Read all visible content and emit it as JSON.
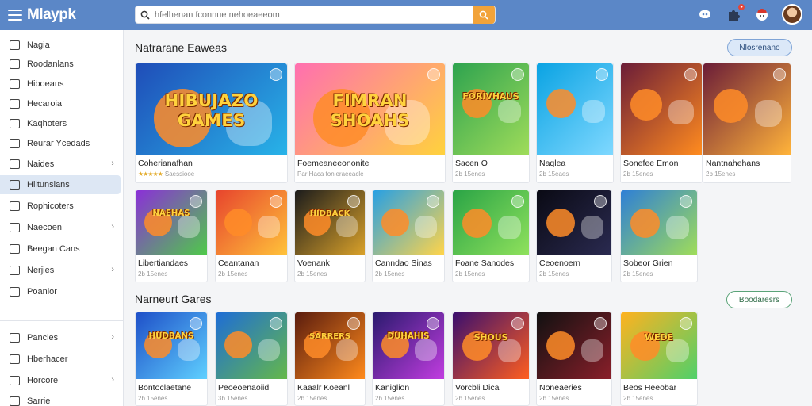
{
  "header": {
    "logo": "Mlaypk",
    "search_placeholder": "hfelhenan fconnue nehoeaeeom"
  },
  "sidebar": {
    "items": [
      {
        "label": "Nagia",
        "chevron": false
      },
      {
        "label": "Roodanlans",
        "chevron": false
      },
      {
        "label": "Hiboeans",
        "chevron": false
      },
      {
        "label": "Hecaroia",
        "chevron": false
      },
      {
        "label": "Kaqhoters",
        "chevron": false
      },
      {
        "label": "Reurar Ycedads",
        "chevron": false
      },
      {
        "label": "Naides",
        "chevron": true
      },
      {
        "label": "Hiltunsians",
        "chevron": false,
        "active": true
      },
      {
        "label": "Rophicoters",
        "chevron": false
      },
      {
        "label": "Naecoen",
        "chevron": true
      },
      {
        "label": "Beegan Cans",
        "chevron": false
      },
      {
        "label": "Nerjies",
        "chevron": true
      },
      {
        "label": "Poanlor",
        "chevron": false
      }
    ],
    "bottom_items": [
      {
        "label": "Pancies",
        "chevron": true
      },
      {
        "label": "Hberhacer",
        "chevron": false
      },
      {
        "label": "Horcore",
        "chevron": true
      },
      {
        "label": "Sarrie",
        "chevron": false
      }
    ]
  },
  "sections": [
    {
      "title": "Natrarane Eaweas",
      "button": "Nlosrenano"
    },
    {
      "title": "Narneurt Gares",
      "button": "Boodaresrs"
    }
  ],
  "featured": [
    {
      "title": "Coherianafhan",
      "meta": "Saessiooe",
      "rating": "★★★★★",
      "thumb_text": "HIBUJAZO GAMES",
      "bg": [
        "#1f4db8",
        "#28b3e8"
      ]
    },
    {
      "title": "Foemeaneeononite",
      "meta": "Par Haca fonieraeeacle",
      "thumb_text": "FIMRAN SHOAHS",
      "bg": [
        "#ff6fb0",
        "#ffd23d"
      ]
    },
    {
      "title": "Sacen O",
      "meta": "2b 15enes",
      "thumb_text": "FORIVHAUS",
      "bg": [
        "#2ea34f",
        "#9fdc5a"
      ]
    },
    {
      "title": "Naqlea",
      "meta": "2b 15eaes",
      "thumb_text": "",
      "bg": [
        "#0aa3e3",
        "#7fd8ff"
      ]
    },
    {
      "title": "Sonefee Emon",
      "meta": "2b 15enes",
      "thumb_text": "",
      "bg": [
        "#6b1d38",
        "#ff8b1f"
      ]
    },
    {
      "title": "Nantnahehans",
      "meta": "2b 15enes",
      "thumb_text": "",
      "bg": [
        "#6b1d38",
        "#ffb33a"
      ]
    }
  ],
  "row2": [
    {
      "title": "Libertiandaes",
      "meta": "2b 15enes",
      "thumb_text": "NAEHAS",
      "bg": [
        "#8b2fd8",
        "#4fc94a"
      ]
    },
    {
      "title": "Ceantanan",
      "meta": "2b 15enes",
      "thumb_text": "",
      "bg": [
        "#e7442d",
        "#ffc23a"
      ]
    },
    {
      "title": "Voenank",
      "meta": "2b 15enes",
      "thumb_text": "HIDBACK",
      "bg": [
        "#1c1c1c",
        "#d9a12a"
      ]
    },
    {
      "title": "Canndao Sinas",
      "meta": "2b 15enes",
      "thumb_text": "",
      "bg": [
        "#27a0e4",
        "#ffd44a"
      ]
    },
    {
      "title": "Foane Sanodes",
      "meta": "2b 15enes",
      "thumb_text": "",
      "bg": [
        "#2aa446",
        "#8fe15c"
      ]
    },
    {
      "title": "Ceoenoern",
      "meta": "2b 15enes",
      "thumb_text": "",
      "bg": [
        "#0a0a14",
        "#2a2a50"
      ]
    },
    {
      "title": "Sobeor Grien",
      "meta": "2b 15enes",
      "thumb_text": "",
      "bg": [
        "#2e7fd6",
        "#9fdc5a"
      ]
    }
  ],
  "row3": [
    {
      "title": "Bontoclaetane",
      "meta": "2b 15enes",
      "thumb_text": "HUDBANS",
      "bg": [
        "#1e4fc8",
        "#5fd0ff"
      ]
    },
    {
      "title": "Peoeoenaoiid",
      "meta": "3b 15enes",
      "thumb_text": "",
      "bg": [
        "#1e6dd6",
        "#65b84a"
      ]
    },
    {
      "title": "Kaaalr Koeanl",
      "meta": "2b 15enes",
      "thumb_text": "SARRERS",
      "bg": [
        "#5a1c0e",
        "#ff8a1c"
      ]
    },
    {
      "title": "Kaniglion",
      "meta": "2b 15enes",
      "thumb_text": "DUHAHIS",
      "bg": [
        "#2a1a6e",
        "#c13de0"
      ]
    },
    {
      "title": "Vorcbli Dica",
      "meta": "2b 15enes",
      "thumb_text": "SHOUS",
      "bg": [
        "#3a0f6e",
        "#ff5e1f"
      ]
    },
    {
      "title": "Noneaeries",
      "meta": "2b 15enes",
      "thumb_text": "",
      "bg": [
        "#111111",
        "#8a1f2a"
      ]
    },
    {
      "title": "Beos Heeobar",
      "meta": "2b 15enes",
      "thumb_text": "WEDE",
      "bg": [
        "#ffb21f",
        "#4fd06a"
      ]
    }
  ],
  "colors": {
    "topbar": "#5b87c7",
    "search_button": "#f2a33a",
    "active_side": "#dde7f4"
  }
}
